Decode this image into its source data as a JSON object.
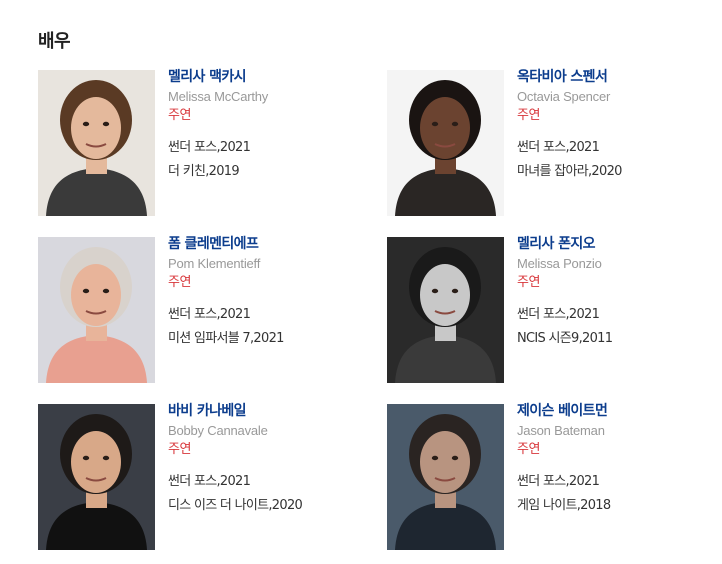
{
  "section": {
    "title": "배우"
  },
  "actors": [
    {
      "name_ko": "멜리사 맥카시",
      "name_en": "Melissa McCarthy",
      "role": "주연",
      "works": [
        "썬더 포스,2021",
        "더 키친,2019"
      ],
      "photo": {
        "bg": "#e8e4de",
        "skin": "#e4b99c",
        "hair": "#5a3a24",
        "top": "#3a3a3a"
      }
    },
    {
      "name_ko": "옥타비아 스펜서",
      "name_en": "Octavia Spencer",
      "role": "주연",
      "works": [
        "썬더 포스,2021",
        "마녀를 잡아라,2020"
      ],
      "photo": {
        "bg": "#f4f4f4",
        "skin": "#6b4330",
        "hair": "#1a1412",
        "top": "#2a2624"
      }
    },
    {
      "name_ko": "폼 클레멘티에프",
      "name_en": "Pom Klementieff",
      "role": "주연",
      "works": [
        "썬더 포스,2021",
        "미션 임파서블 7,2021"
      ],
      "photo": {
        "bg": "#d8d8de",
        "skin": "#e8b49a",
        "hair": "#d8d2cc",
        "top": "#e8a090"
      }
    },
    {
      "name_ko": "멜리사 폰지오",
      "name_en": "Melissa Ponzio",
      "role": "주연",
      "works": [
        "썬더 포스,2021",
        "NCIS 시즌9,2011"
      ],
      "photo": {
        "bg": "#2a2a2a",
        "skin": "#c8c8c8",
        "hair": "#1a1a1a",
        "top": "#3a3a3a"
      }
    },
    {
      "name_ko": "바비 카나베일",
      "name_en": "Bobby Cannavale",
      "role": "주연",
      "works": [
        "썬더 포스,2021",
        "디스 이즈 더 나이트,2020"
      ],
      "photo": {
        "bg": "#3a3e46",
        "skin": "#d8a888",
        "hair": "#1e1a18",
        "top": "#111111"
      }
    },
    {
      "name_ko": "제이슨 베이트먼",
      "name_en": "Jason Bateman",
      "role": "주연",
      "works": [
        "썬더 포스,2021",
        "게임 나이트,2018"
      ],
      "photo": {
        "bg": "#4a5a6a",
        "skin": "#b89480",
        "hair": "#2a2422",
        "top": "#1e2630"
      }
    }
  ]
}
